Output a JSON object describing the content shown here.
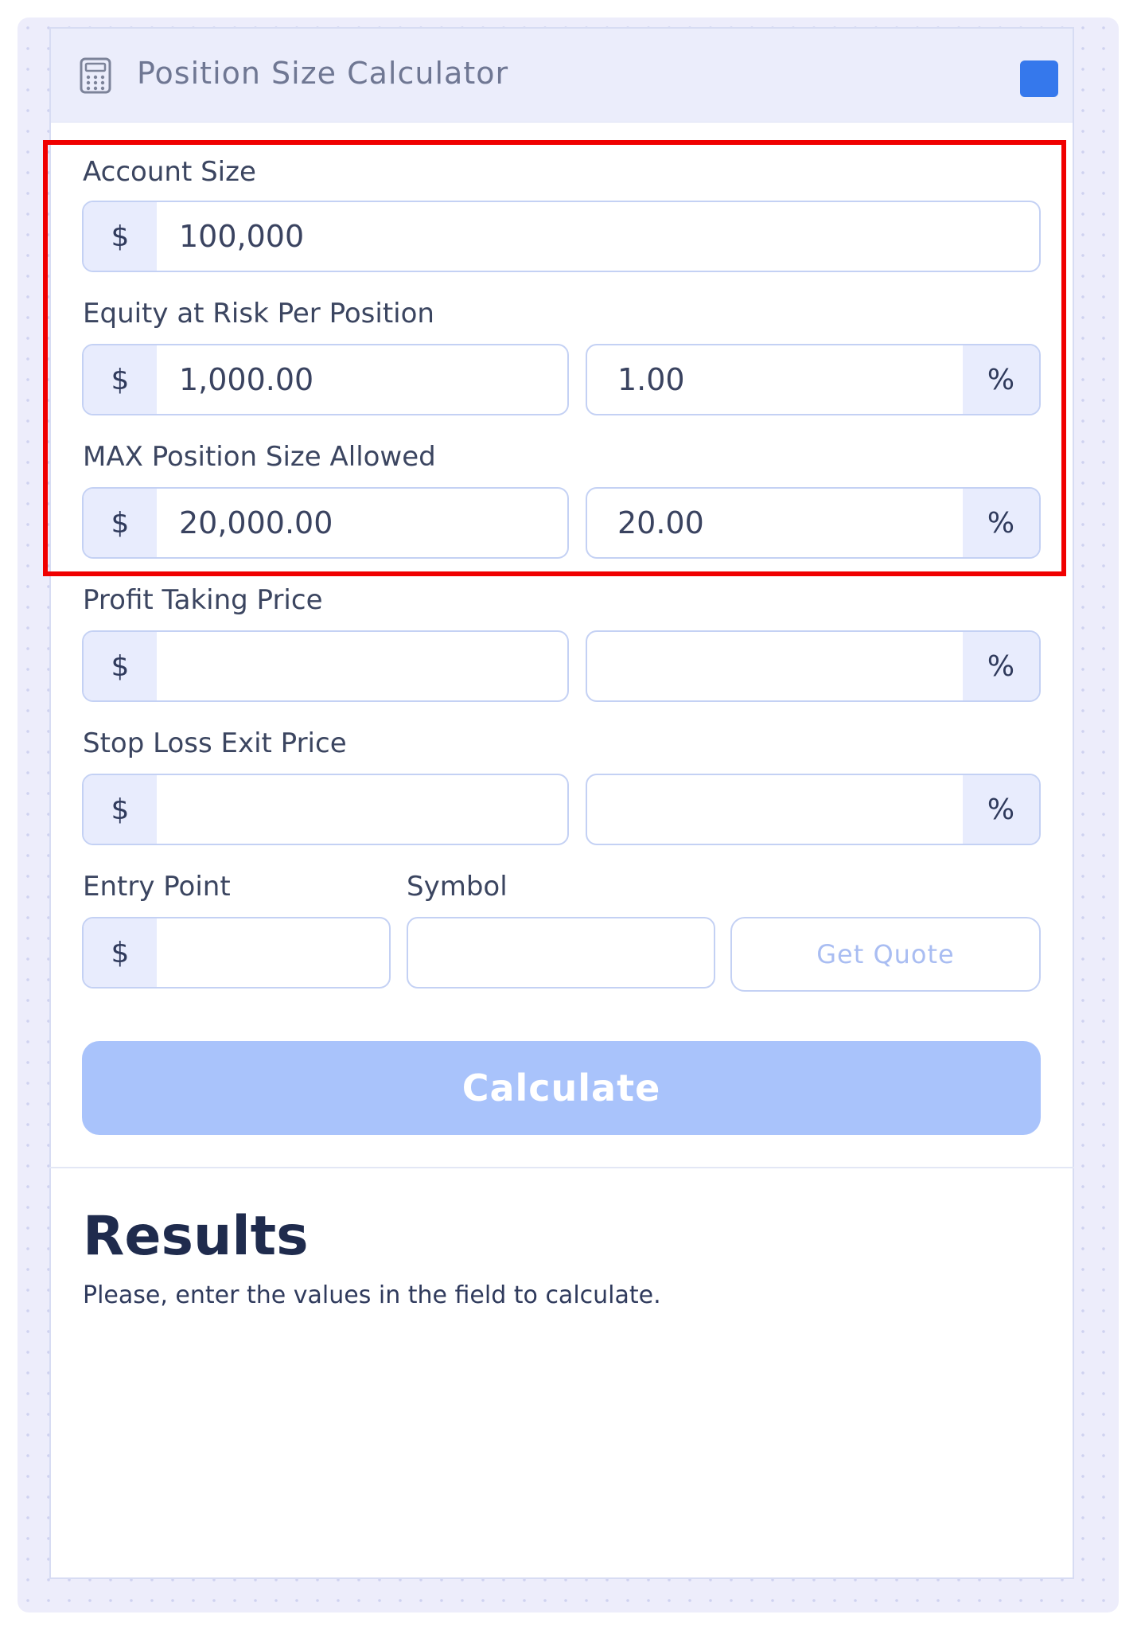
{
  "header": {
    "title": "Position Size Calculator",
    "icon": "calculator-icon",
    "accent_color": "#3578ec"
  },
  "account_size": {
    "label": "Account Size",
    "currency": "$",
    "value": "100,000"
  },
  "equity_at_risk": {
    "label": "Equity at Risk Per Position",
    "currency": "$",
    "amount": "1,000.00",
    "percent": "1.00",
    "percent_symbol": "%"
  },
  "max_position": {
    "label": "MAX Position Size Allowed",
    "currency": "$",
    "amount": "20,000.00",
    "percent": "20.00",
    "percent_symbol": "%"
  },
  "profit_taking": {
    "label": "Profit Taking Price",
    "currency": "$",
    "amount": "",
    "percent": "",
    "percent_symbol": "%"
  },
  "stop_loss": {
    "label": "Stop Loss Exit Price",
    "currency": "$",
    "amount": "",
    "percent": "",
    "percent_symbol": "%"
  },
  "entry_point": {
    "label": "Entry Point",
    "currency": "$",
    "value": ""
  },
  "symbol": {
    "label": "Symbol",
    "value": ""
  },
  "buttons": {
    "get_quote": "Get Quote",
    "calculate": "Calculate"
  },
  "results": {
    "title": "Results",
    "message": "Please, enter the values in the field to calculate."
  },
  "colors": {
    "highlight_border": "#f00000",
    "calculate_button": "#a9c3fb"
  }
}
